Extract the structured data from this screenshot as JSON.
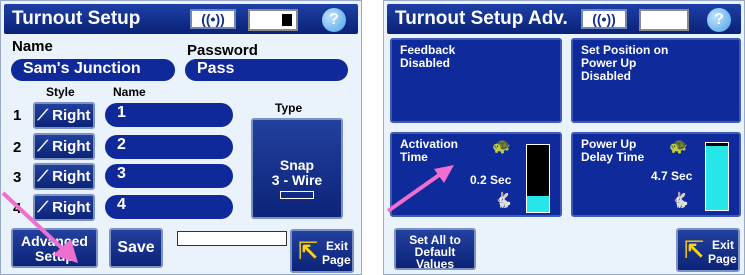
{
  "left": {
    "title": "Turnout Setup",
    "signal_label": "((•))",
    "help_label": "?",
    "name_label": "Name",
    "name_value": "Sam's Junction",
    "password_label": "Password",
    "password_value": "Pass",
    "style_header": "Style",
    "name_header": "Name",
    "type_header": "Type",
    "rows": [
      {
        "num": "1",
        "style": "Right",
        "name": "1"
      },
      {
        "num": "2",
        "style": "Right",
        "name": "2"
      },
      {
        "num": "3",
        "style": "Right",
        "name": "3"
      },
      {
        "num": "4",
        "style": "Right",
        "name": "4"
      }
    ],
    "type_button": {
      "line1": "Snap",
      "line2": "3 - Wire"
    },
    "advanced_setup_label_1": "Advanced",
    "advanced_setup_label_2": "Setup",
    "save_label": "Save",
    "exit_label_1": "Exit",
    "exit_label_2": "Page"
  },
  "right": {
    "title": "Turnout Setup Adv.",
    "signal_label": "((•))",
    "help_label": "?",
    "feedback": {
      "line1": "Feedback",
      "line2": "Disabled"
    },
    "set_position": {
      "line1": "Set Position on",
      "line2": "Power Up",
      "line3": "Disabled"
    },
    "activation": {
      "line1": "Activation",
      "line2": "Time",
      "value": "0.2 Sec",
      "level": 0.24
    },
    "power_up_delay": {
      "line1": "Power Up",
      "line2": "Delay Time",
      "value": "4.7 Sec",
      "level": 0.95
    },
    "set_all_default": {
      "line1": "Set All to",
      "line2": "Default",
      "line3": "Values"
    },
    "exit_label_1": "Exit",
    "exit_label_2": "Page"
  },
  "colors": {
    "title_bar": "#0a2276",
    "button_blue": "#10299a",
    "gauge_fill": "#27e6ea",
    "arrow_pink": "#ef6fd0"
  },
  "icons": [
    "signal-icon",
    "battery-icon",
    "help-icon",
    "turnout-icon",
    "turtle-icon",
    "rabbit-icon",
    "exit-icon"
  ]
}
